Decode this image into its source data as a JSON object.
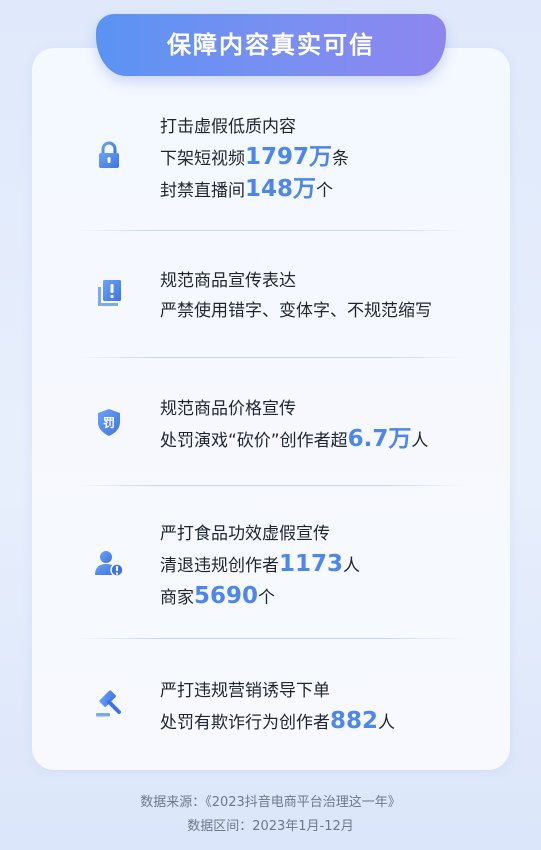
{
  "banner": {
    "title": "保障内容真实可信"
  },
  "items": [
    {
      "icon": "lock-icon",
      "l1": "打击虚假低质内容",
      "l2_pre": "下架短视频",
      "l2_num": "1797万",
      "l2_post": "条",
      "l3_pre": "封禁直播间",
      "l3_num": "148万",
      "l3_post": "个"
    },
    {
      "icon": "document-alert-icon",
      "l1": "规范商品宣传表达",
      "l2": "严禁使用错字、变体字、不规范缩写"
    },
    {
      "icon": "penalty-shield-icon",
      "icon_text": "罚",
      "l1": "规范商品价格宣传",
      "l2_pre": "处罚演戏“砍价”创作者超",
      "l2_num": "6.7万",
      "l2_post": "人"
    },
    {
      "icon": "user-warning-icon",
      "l1": "严打食品功效虚假宣传",
      "l2_pre": "清退违规创作者",
      "l2_num": "1173",
      "l2_post": "人",
      "l3_pre": "商家",
      "l3_num": "5690",
      "l3_post": "个"
    },
    {
      "icon": "gavel-icon",
      "l1": "严打违规营销诱导下单",
      "l2_pre": "处罚有欺诈行为创作者",
      "l2_num": "882",
      "l2_post": "人"
    }
  ],
  "footer": {
    "source": "数据来源：《2023抖音电商平台治理这一年》",
    "range": "数据区间：2023年1月-12月"
  },
  "colors": {
    "accent": "#4d86ec",
    "banner_start": "#5a93f3",
    "banner_end": "#8e86ef"
  }
}
